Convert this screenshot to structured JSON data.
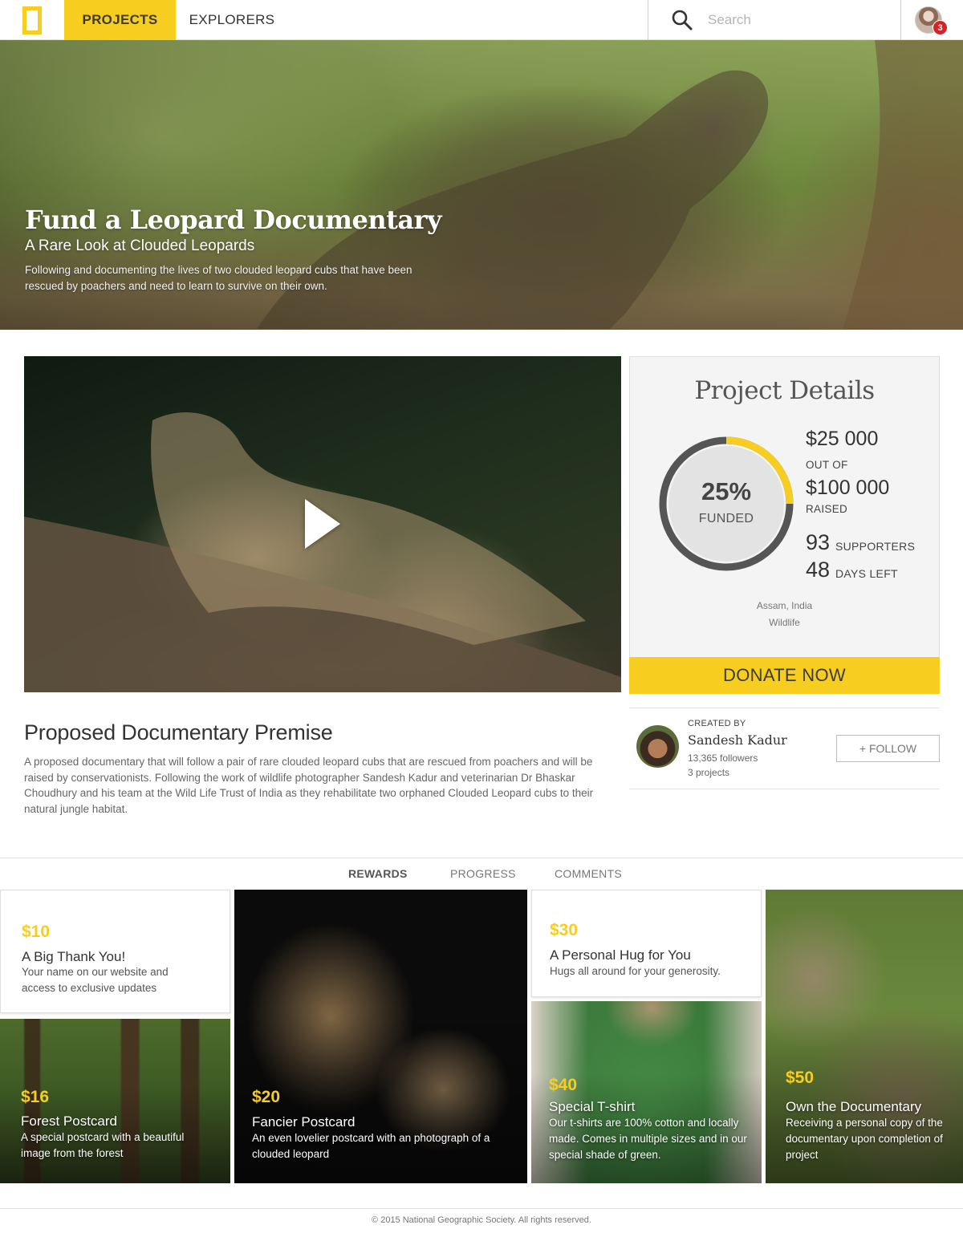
{
  "nav": {
    "tabs": [
      {
        "label": "PROJECTS",
        "active": true
      },
      {
        "label": "EXPLORERS",
        "active": false
      }
    ],
    "search": {
      "placeholder": "Search",
      "icon": "search-icon"
    },
    "notifications_count": "3",
    "brand_color": "#f7cd1f"
  },
  "hero": {
    "title": "Fund a Leopard Documentary",
    "subtitle": "A Rare Look at Clouded Leopards",
    "description": "Following and documenting the lives of two clouded leopard cubs that have been rescued by poachers and need to learn to survive on their own."
  },
  "video": {
    "play_icon": "play-icon"
  },
  "details": {
    "title": "Project Details",
    "funded_percent": "25%",
    "funded_fraction": 0.25,
    "funded_label": "FUNDED",
    "raised_amount": "$25 000",
    "out_of_label": "OUT OF",
    "goal_amount": "$100 000",
    "raised_label": "RAISED",
    "supporters_count": "93",
    "supporters_label": "SUPPORTERS",
    "days_left": "48",
    "days_left_label": "DAYS LEFT",
    "location": "Assam, India",
    "category": "Wildlife",
    "donate_label": "DONATE NOW",
    "ring_color": "#f7cd1f",
    "ring_track_color": "#555555"
  },
  "creator": {
    "created_by_label": "CREATED BY",
    "name": "Sandesh Kadur",
    "followers": "13,365 followers",
    "projects": "3 projects",
    "follow_label": "+ FOLLOW"
  },
  "premise": {
    "title": "Proposed Documentary Premise",
    "body": "A proposed documentary that will follow a pair of rare clouded leopard cubs that are rescued from poachers and will be raised by conservationists. Following the work of wildlife photographer Sandesh Kadur and veterinarian Dr Bhaskar Choudhury and his team at the Wild Life Trust of India as they rehabilitate two orphaned Clouded Leopard cubs to their natural jungle habitat."
  },
  "tabs": [
    {
      "label": "REWARDS",
      "active": true
    },
    {
      "label": "PROGRESS",
      "active": false
    },
    {
      "label": "COMMENTS",
      "active": false
    }
  ],
  "rewards": [
    {
      "price": "$10",
      "title": "A Big Thank You!",
      "description": "Your name on our website and access to exclusive updates"
    },
    {
      "price": "$16",
      "title": "Forest Postcard",
      "description": "A special postcard with a beautiful image from the forest"
    },
    {
      "price": "$20",
      "title": "Fancier Postcard",
      "description": "An even lovelier postcard with an photograph of a clouded leopard"
    },
    {
      "price": "$30",
      "title": "A Personal Hug for You",
      "description": "Hugs all around for your generosity."
    },
    {
      "price": "$40",
      "title": "Special T-shirt",
      "description": "Our t-shirts are 100% cotton and locally made. Comes in multiple sizes and in our special shade of green."
    },
    {
      "price": "$50",
      "title": "Own the Documentary",
      "description": "Receiving a personal copy of the documentary upon completion of project"
    }
  ],
  "footer": {
    "copyright": "© 2015 National Geographic Society. All rights reserved."
  }
}
